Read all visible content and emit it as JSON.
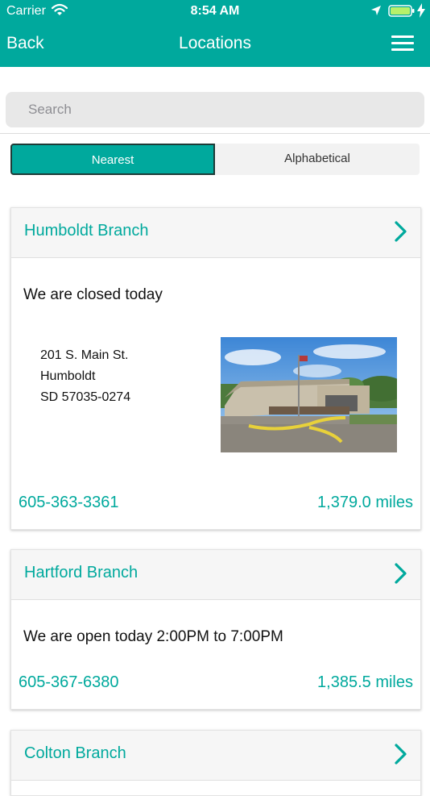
{
  "status_bar": {
    "carrier": "Carrier",
    "time": "8:54 AM"
  },
  "nav": {
    "back_label": "Back",
    "title": "Locations",
    "menu_icon": "hamburger-menu-icon"
  },
  "search": {
    "placeholder": "Search",
    "value": ""
  },
  "segments": {
    "nearest": "Nearest",
    "alphabetical": "Alphabetical",
    "selected": "Nearest"
  },
  "colors": {
    "accent": "#00A99D",
    "header_bg": "#00A99D",
    "card_header_bg": "#f6f6f6"
  },
  "branches": [
    {
      "name": "Humboldt Branch",
      "status": "We are closed today",
      "address": {
        "street": "201 S. Main St.",
        "city": "Humboldt",
        "state_zip": "SD 57035-0274"
      },
      "phone": "605-363-3361",
      "distance": "1,379.0 miles",
      "has_photo": true
    },
    {
      "name": "Hartford Branch",
      "status": "We are open today 2:00PM to 7:00PM",
      "phone": "605-367-6380",
      "distance": "1,385.5 miles"
    },
    {
      "name": "Colton Branch"
    }
  ]
}
